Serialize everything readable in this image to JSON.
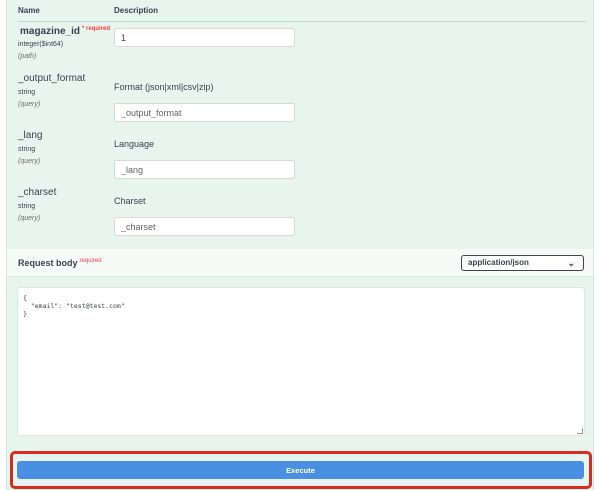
{
  "parameters": {
    "header": {
      "name": "Name",
      "description": "Description"
    },
    "items": [
      {
        "name": "magazine_id",
        "required": "* required",
        "type": "integer($int64)",
        "in": "(path)",
        "description": "",
        "value": "1",
        "placeholder": ""
      },
      {
        "name": "_output_format",
        "type": "string",
        "in": "(query)",
        "description": "Format (json|xml|csv|zip)",
        "value": "",
        "placeholder": "_output_format"
      },
      {
        "name": "_lang",
        "type": "string",
        "in": "(query)",
        "description": "Language",
        "value": "",
        "placeholder": "_lang"
      },
      {
        "name": "_charset",
        "type": "string",
        "in": "(query)",
        "description": "Charset",
        "value": "",
        "placeholder": "_charset"
      }
    ]
  },
  "request_body": {
    "title": "Request body",
    "required": "required",
    "content_type": "application/json",
    "code": "{\n  \"email\": \"test@test.com\"\n}"
  },
  "execute": {
    "label": "Execute"
  },
  "colors": {
    "panel_bg": "#e8f4ee",
    "execute_button": "#4990e2",
    "highlight_border": "#d72c1d",
    "required_red": "#f93e3e"
  },
  "icons": {
    "select_chevron": "chevron-down-icon",
    "resize_grip": "resize-grip-icon"
  }
}
